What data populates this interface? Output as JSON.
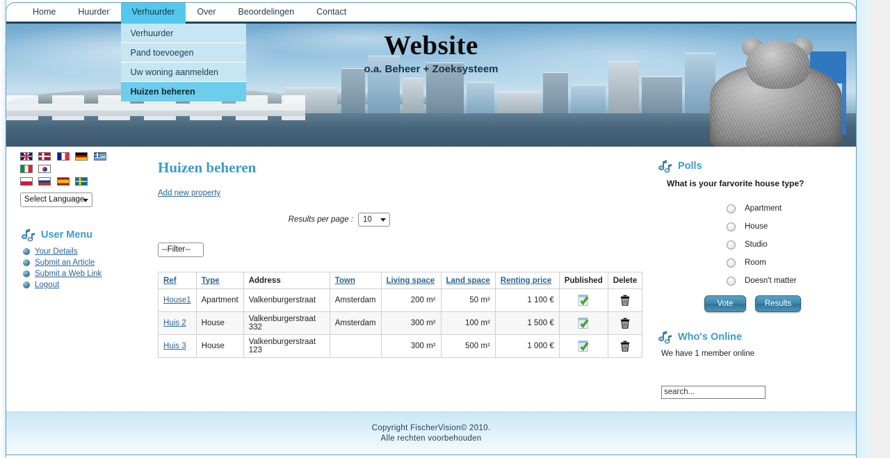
{
  "nav": {
    "items": [
      {
        "label": "Home",
        "active": false
      },
      {
        "label": "Huurder",
        "active": false
      },
      {
        "label": "Verhuurder",
        "active": true
      },
      {
        "label": "Over",
        "active": false
      },
      {
        "label": "Beoordelingen",
        "active": false
      },
      {
        "label": "Contact",
        "active": false
      }
    ],
    "dropdown": [
      {
        "label": "Verhuurder",
        "current": false
      },
      {
        "label": "Pand toevoegen",
        "current": false
      },
      {
        "label": "Uw woning aanmelden",
        "current": false
      },
      {
        "label": "Huizen beheren",
        "current": true
      }
    ]
  },
  "banner": {
    "title": "Website",
    "subtitle": "o.a. Beheer + Zoeksysteem"
  },
  "sidebar_left": {
    "flags": [
      {
        "name": "flag-uk",
        "class": "f-uk"
      },
      {
        "name": "flag-denmark",
        "class": "f-dk"
      },
      {
        "name": "flag-france",
        "class": "f-fr"
      },
      {
        "name": "flag-germany",
        "class": "f-de"
      },
      {
        "name": "flag-greece",
        "class": "f-gr"
      },
      {
        "name": "flag-italy",
        "class": "f-it"
      },
      {
        "name": "flag-south-korea",
        "class": "f-kr"
      },
      {
        "name": "flag-poland",
        "class": "f-pl"
      },
      {
        "name": "flag-russia",
        "class": "f-ru"
      },
      {
        "name": "flag-spain",
        "class": "f-es"
      },
      {
        "name": "flag-sweden",
        "class": "f-se"
      }
    ],
    "language_select": "Select Language",
    "user_menu": {
      "title": "User Menu",
      "items": [
        {
          "label": "Your Details"
        },
        {
          "label": "Submit an Article"
        },
        {
          "label": "Submit a Web Link"
        },
        {
          "label": "Logout"
        }
      ]
    }
  },
  "main": {
    "page_title": "Huizen beheren",
    "add_new_label": "Add new property",
    "results_per_page_label": "Results per page :",
    "results_per_page_value": "10",
    "filter_value": "--Filter--",
    "table": {
      "headers": [
        {
          "label": "Ref",
          "link": true,
          "align": "left"
        },
        {
          "label": "Type",
          "link": true,
          "align": "left"
        },
        {
          "label": "Address",
          "link": false,
          "align": "left"
        },
        {
          "label": "Town",
          "link": true,
          "align": "left"
        },
        {
          "label": "Living space",
          "link": true,
          "align": "left"
        },
        {
          "label": "Land space",
          "link": true,
          "align": "left"
        },
        {
          "label": "Renting price",
          "link": true,
          "align": "left"
        },
        {
          "label": "Published",
          "link": false,
          "align": "center"
        },
        {
          "label": "Delete",
          "link": false,
          "align": "center"
        }
      ],
      "rows": [
        {
          "ref": "House1",
          "type": "Apartment",
          "address": "Valkenburgerstraat",
          "town": "Amsterdam",
          "living_space": "200 m²",
          "land_space": "50 m²",
          "renting_price": "1 100 €",
          "published": "published-check-icon",
          "delete": "trash-icon"
        },
        {
          "ref": "Huis 2",
          "type": "House",
          "address": "Valkenburgerstraat 332",
          "town": "Amsterdam",
          "living_space": "300 m²",
          "land_space": "100 m²",
          "renting_price": "1 500 €",
          "published": "published-check-icon",
          "delete": "trash-icon"
        },
        {
          "ref": "Huis 3",
          "type": "House",
          "address": "Valkenburgerstraat 123",
          "town": "",
          "living_space": "300 m²",
          "land_space": "500 m²",
          "renting_price": "1 000 €",
          "published": "published-check-icon",
          "delete": "trash-icon"
        }
      ]
    }
  },
  "sidebar_right": {
    "polls": {
      "title": "Polls",
      "question": "What is your farvorite house type?",
      "options": [
        {
          "label": "Apartment",
          "selected": false
        },
        {
          "label": "House",
          "selected": false
        },
        {
          "label": "Studio",
          "selected": false
        },
        {
          "label": "Room",
          "selected": false
        },
        {
          "label": "Doesn't matter",
          "selected": false
        }
      ],
      "vote_label": "Vote",
      "results_label": "Results"
    },
    "whos_online": {
      "title": "Who's Online",
      "text": "We have 1 member online"
    },
    "search_placeholder": "search..."
  },
  "footer": {
    "line1": "Copyright FischerVision© 2010.",
    "line2": "Alle rechten voorbehouden"
  },
  "colors": {
    "accent": "#3a9cc8",
    "nav_active": "#54c8ec",
    "dropdown_bg": "#c6e6f4",
    "dropdown_current": "#6ecdea",
    "link": "#2a6496",
    "nav_border": "#1d4558",
    "footer_bg": "#cbe6f3"
  }
}
